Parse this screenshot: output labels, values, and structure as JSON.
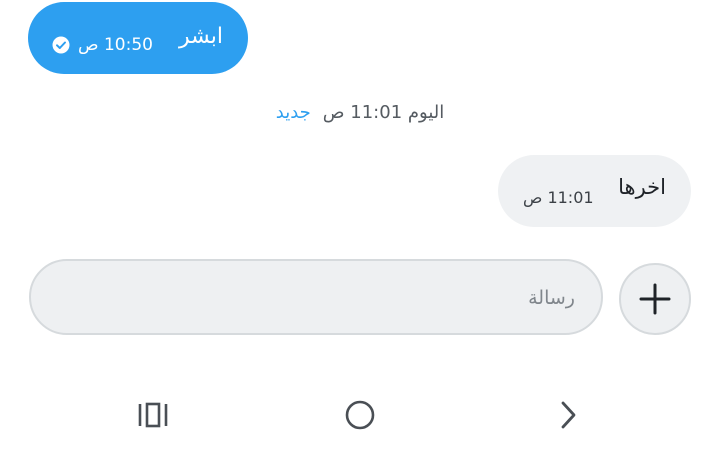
{
  "messages": {
    "sent": {
      "text": "ابشر",
      "time": "10:50 ص",
      "status_icon": "check-circle-icon"
    },
    "separator": {
      "date": "اليوم 11:01 ص",
      "new_label": "جديد"
    },
    "received": {
      "text": "اخرها",
      "time": "11:01 ص"
    }
  },
  "composer": {
    "placeholder": "رسالة",
    "value": "",
    "add_icon": "plus-icon"
  },
  "navbar": {
    "recents_icon": "recents-icon",
    "home_icon": "home-circle-icon",
    "back_icon": "chevron-right-icon"
  },
  "colors": {
    "accent": "#2d9ff0",
    "sent_bubble": "#2d9ff0",
    "received_bubble": "#eff1f3",
    "input_background": "#eef0f2"
  }
}
